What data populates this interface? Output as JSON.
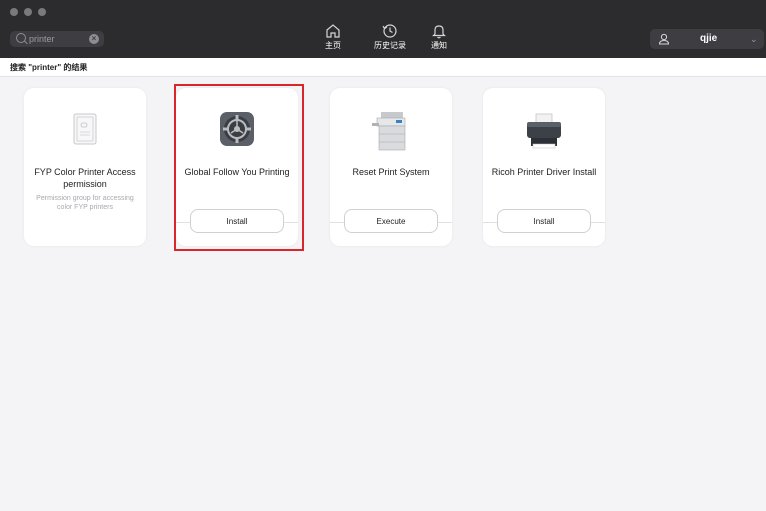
{
  "window": {
    "traffic_lights": [
      "close",
      "minimize",
      "zoom"
    ]
  },
  "search": {
    "value": "printer",
    "clear_icon": "x-circle-icon"
  },
  "nav": [
    {
      "label": "主页",
      "icon": "home-icon"
    },
    {
      "label": "历史记录",
      "icon": "history-icon"
    },
    {
      "label": "通知",
      "icon": "bell-icon"
    }
  ],
  "user": {
    "name": "qjie",
    "icon": "user-icon",
    "chevron": "⌄"
  },
  "results": {
    "title": "搜索 \"printer\" 的结果"
  },
  "cards": [
    {
      "title": "FYP Color Printer Access permission",
      "description": "Permission group for accessing color FYP printers",
      "icon": "document-badge-icon",
      "button": ""
    },
    {
      "title": "Global Follow You Printing",
      "description": "",
      "icon": "gear-app-icon",
      "button": "Install",
      "highlighted": true,
      "highlight_color": "#d8262c"
    },
    {
      "title": "Reset Print System",
      "description": "",
      "icon": "copier-icon",
      "button": "Execute"
    },
    {
      "title": "Ricoh Printer Driver Install",
      "description": "",
      "icon": "printer-icon",
      "button": "Install"
    }
  ],
  "colors": {
    "topbar": "#2c2c2e",
    "background": "#f4f4f6",
    "accent": "#d8262c"
  }
}
